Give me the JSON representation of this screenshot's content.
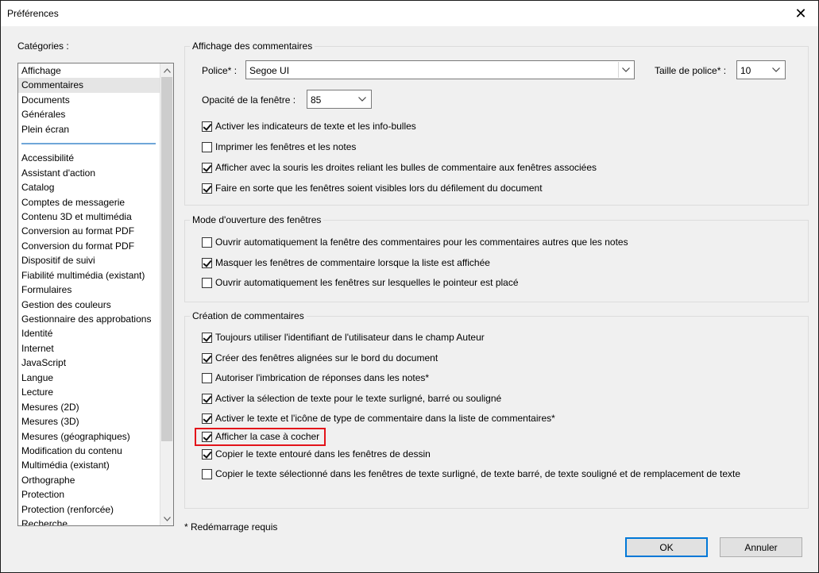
{
  "window": {
    "title": "Préférences",
    "close_glyph": "✕"
  },
  "categories": {
    "label": "Catégories :",
    "top_items": [
      "Affichage",
      "Commentaires",
      "Documents",
      "Générales",
      "Plein écran"
    ],
    "selected": "Commentaires",
    "items": [
      "Accessibilité",
      "Assistant d'action",
      "Catalog",
      "Comptes de messagerie",
      "Contenu 3D et multimédia",
      "Conversion au format PDF",
      "Conversion du format PDF",
      "Dispositif de suivi",
      "Fiabilité multimédia (existant)",
      "Formulaires",
      "Gestion des couleurs",
      "Gestionnaire des approbations",
      "Identité",
      "Internet",
      "JavaScript",
      "Langue",
      "Lecture",
      "Mesures (2D)",
      "Mesures (3D)",
      "Mesures (géographiques)",
      "Modification du contenu",
      "Multimédia (existant)",
      "Orthographe",
      "Protection",
      "Protection (renforcée)",
      "Recherche"
    ]
  },
  "affichage": {
    "title": "Affichage des commentaires",
    "police_label": "Police* :",
    "police_value": "Segoe UI",
    "taille_label": "Taille de police* :",
    "taille_value": "10",
    "opacite_label": "Opacité de la fenêtre :",
    "opacite_value": "85",
    "checkboxes": [
      {
        "label": "Activer les indicateurs de texte et les info-bulles",
        "checked": true
      },
      {
        "label": "Imprimer les fenêtres et les notes",
        "checked": false
      },
      {
        "label": "Afficher avec la souris les droites reliant les bulles de commentaire aux fenêtres associées",
        "checked": true
      },
      {
        "label": "Faire en sorte que les fenêtres soient visibles lors du défilement du document",
        "checked": true
      }
    ]
  },
  "ouverture": {
    "title": "Mode d'ouverture des fenêtres",
    "checkboxes": [
      {
        "label": "Ouvrir automatiquement la fenêtre des commentaires pour les commentaires autres que les notes",
        "checked": false
      },
      {
        "label": "Masquer les fenêtres de commentaire lorsque la liste est affichée",
        "checked": true
      },
      {
        "label": "Ouvrir automatiquement les fenêtres sur lesquelles le pointeur est placé",
        "checked": false
      }
    ]
  },
  "creation": {
    "title": "Création de commentaires",
    "checkboxes": [
      {
        "label": "Toujours utiliser l'identifiant de l'utilisateur dans le champ Auteur",
        "checked": true
      },
      {
        "label": "Créer des fenêtres alignées sur le bord du document",
        "checked": true
      },
      {
        "label": "Autoriser l'imbrication de réponses dans les notes*",
        "checked": false
      },
      {
        "label": "Activer la sélection de texte pour le texte surligné, barré ou souligné",
        "checked": true
      },
      {
        "label": "Activer le texte et l'icône de type de commentaire dans la liste de commentaires*",
        "checked": true
      },
      {
        "label": "Afficher la case à cocher",
        "checked": true
      },
      {
        "label": "Copier le texte entouré dans les fenêtres de dessin",
        "checked": true
      },
      {
        "label": "Copier le texte sélectionné dans les fenêtres de texte surligné, de texte barré, de texte souligné et de remplacement de texte",
        "checked": false
      }
    ]
  },
  "footer": {
    "note": "* Redémarrage requis",
    "ok_label": "OK",
    "cancel_label": "Annuler"
  },
  "colors": {
    "highlight": "#e3131a",
    "default_button_border": "#0078d7",
    "separator": "#6fa6d8"
  }
}
